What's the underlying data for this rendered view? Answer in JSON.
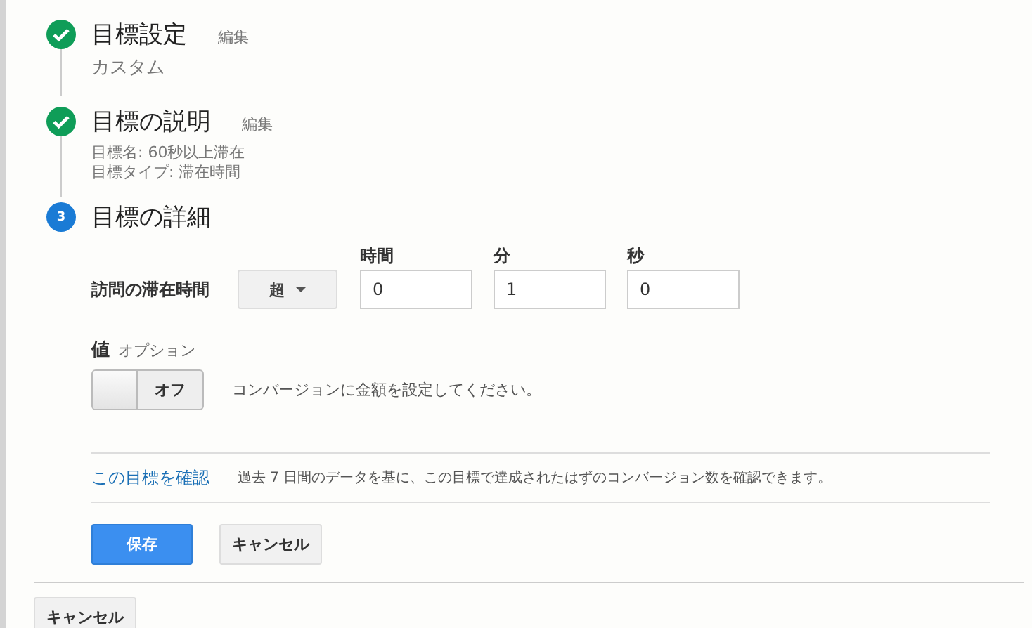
{
  "steps": [
    {
      "kind": "done",
      "title": "目標設定",
      "edit": "編集",
      "details": [
        "カスタム"
      ]
    },
    {
      "kind": "done",
      "title": "目標の説明",
      "edit": "編集",
      "details": [
        "目標名: 60秒以上滞在",
        "目標タイプ: 滞在時間"
      ]
    },
    {
      "kind": "current",
      "number": "3",
      "title": "目標の詳細"
    }
  ],
  "duration": {
    "label": "訪問の滞在時間",
    "operator": "超",
    "fields": [
      {
        "label": "時間",
        "value": "0"
      },
      {
        "label": "分",
        "value": "1"
      },
      {
        "label": "秒",
        "value": "0"
      }
    ]
  },
  "value": {
    "label": "値",
    "hint": "オプション",
    "toggle": {
      "on": false,
      "label": "オフ"
    },
    "description": "コンバージョンに金額を設定してください。"
  },
  "verify": {
    "link": "この目標を確認",
    "text": "過去 7 日間のデータを基に、この目標で達成されたはずのコンバージョン数を確認できます。"
  },
  "buttons": [
    {
      "label": "保存",
      "kind": "primary"
    },
    {
      "label": "キャンセル",
      "kind": "secondary"
    }
  ],
  "footer_button": "キャンセル"
}
